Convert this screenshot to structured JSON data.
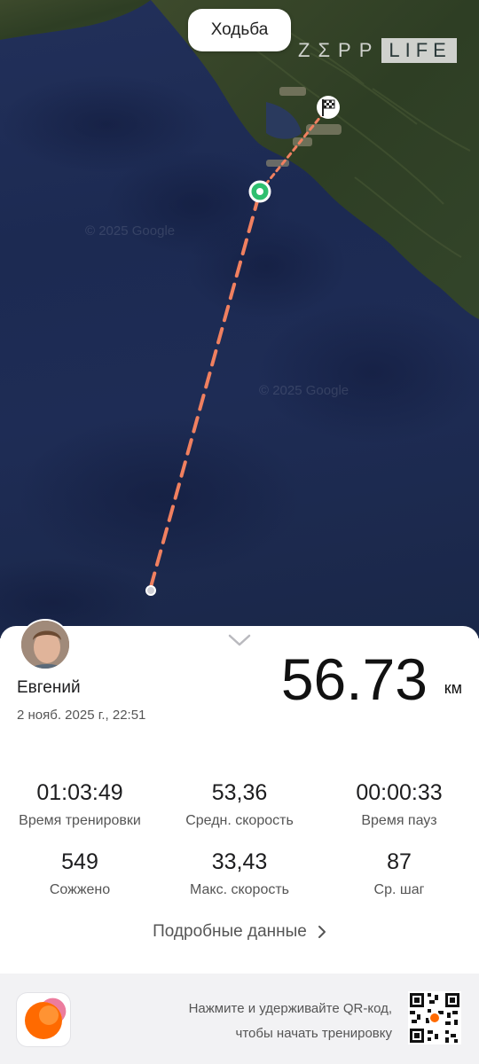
{
  "map": {
    "activity_label": "Ходьба",
    "brand_zepp": "ZΣPP",
    "brand_life": "LIFE",
    "watermarks": [
      "© 2025 Google",
      "© 2025 Google"
    ],
    "route_color": "#f08060",
    "start_marker_color": "#2fbf6f"
  },
  "summary": {
    "user_name": "Евгений",
    "date": "2 нояб. 2025 г., 22:51",
    "distance": "56.73",
    "distance_unit": "км"
  },
  "stats": [
    {
      "value": "01:03:49",
      "label": "Время тренировки"
    },
    {
      "value": "53,36",
      "label": "Средн. скорость"
    },
    {
      "value": "00:00:33",
      "label": "Время пауз"
    },
    {
      "value": "549",
      "label": "Сожжено"
    },
    {
      "value": "33,43",
      "label": "Макс. скорость"
    },
    {
      "value": "87",
      "label": "Ср. шаг"
    }
  ],
  "details_link": "Подробные данные",
  "footer": {
    "qr_hint_line1": "Нажмите и удерживайте QR-код,",
    "qr_hint_line2": "чтобы начать тренировку"
  },
  "colors": {
    "accent_orange": "#ff6a00",
    "background": "#f2f2f4"
  }
}
